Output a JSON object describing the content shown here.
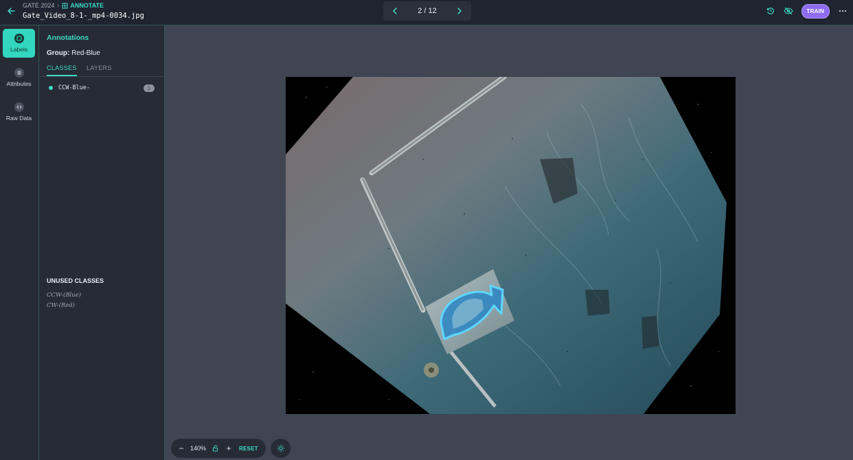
{
  "header": {
    "project": "GATE 2024",
    "mode": "ANNOTATE",
    "filename": "Gate_Video_8-1-_mp4-0034.jpg",
    "pager": "2 / 12",
    "train_label": "TRAIN"
  },
  "rail": {
    "items": [
      {
        "label": "Labels",
        "icon": "label-icon"
      },
      {
        "label": "Attributes",
        "icon": "list-icon"
      },
      {
        "label": "Raw Data",
        "icon": "code-icon"
      }
    ]
  },
  "panel": {
    "title": "Annotations",
    "group_key": "Group:",
    "group_value": "Red-Blue",
    "tabs": [
      "CLASSES",
      "LAYERS"
    ],
    "classes": [
      {
        "name": "CCW-Blue-",
        "count": "1",
        "color": "#3ddbc3"
      }
    ],
    "unused_title": "UNUSED CLASSES",
    "unused": [
      "CCW-(Blue)",
      "CW-(Red)"
    ]
  },
  "zoom": {
    "minus": "−",
    "value": "140%",
    "plus": "+",
    "reset": "RESET"
  },
  "colors": {
    "accent": "#3ddbc3",
    "train": "#8e6cf0",
    "annotation_outline": "#5fd6ff"
  }
}
